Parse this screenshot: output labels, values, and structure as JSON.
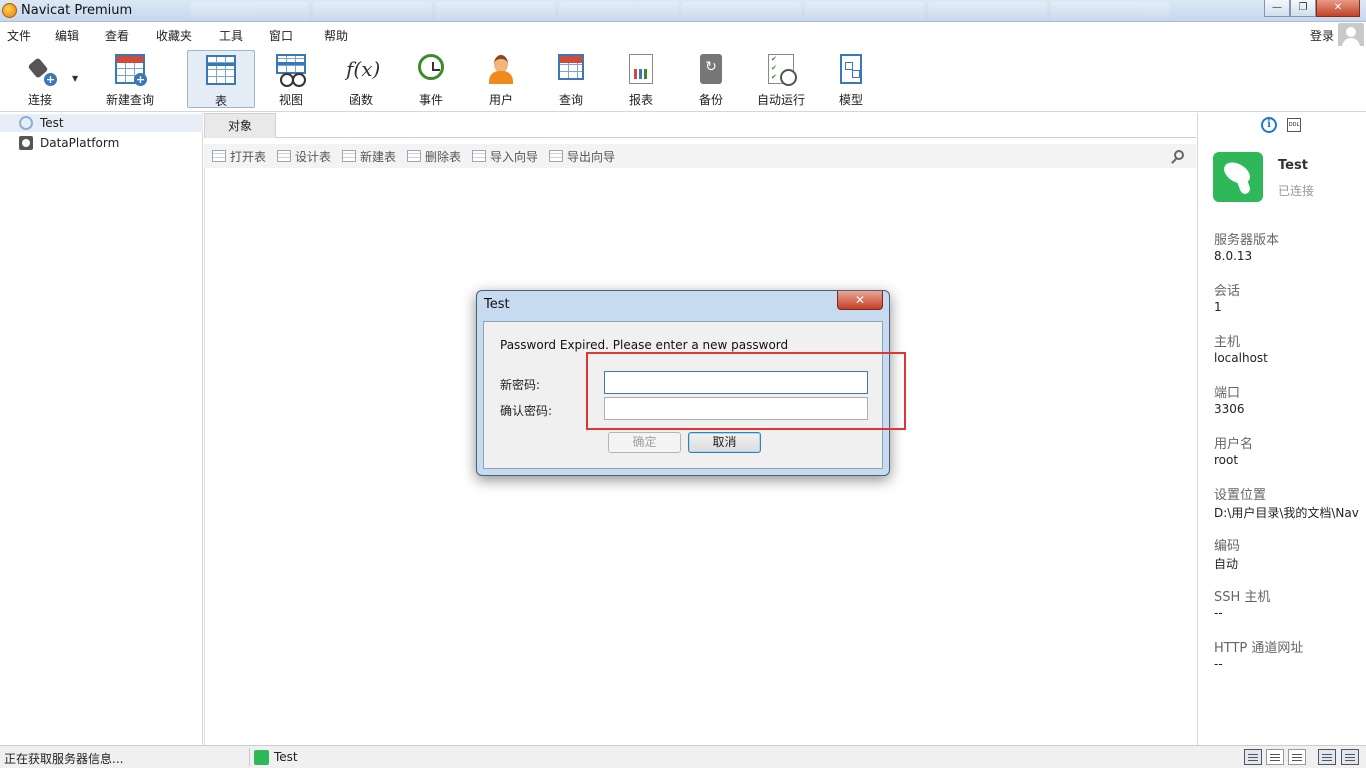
{
  "window": {
    "title": "Navicat Premium",
    "controls": [
      "—",
      "❐",
      "✕"
    ]
  },
  "menu": {
    "items": [
      "文件",
      "编辑",
      "查看",
      "收藏夹",
      "工具",
      "窗口",
      "帮助"
    ],
    "login_label": "登录"
  },
  "toolbar": {
    "connect_label": "连接",
    "new_query_label": "新建查询",
    "buttons": [
      {
        "label": "表",
        "icon": "table-icon",
        "active": true
      },
      {
        "label": "视图",
        "icon": "view-icon"
      },
      {
        "label": "函数",
        "icon": "function-icon",
        "glyph": "f(x)"
      },
      {
        "label": "事件",
        "icon": "event-clock-icon"
      },
      {
        "label": "用户",
        "icon": "user-icon"
      },
      {
        "label": "查询",
        "icon": "query-icon"
      },
      {
        "label": "报表",
        "icon": "report-icon"
      },
      {
        "label": "备份",
        "icon": "backup-icon"
      },
      {
        "label": "自动运行",
        "icon": "automation-icon"
      },
      {
        "label": "模型",
        "icon": "model-icon"
      }
    ]
  },
  "navigator": {
    "items": [
      {
        "label": "Test",
        "icon": "connection-icon",
        "selected": true
      },
      {
        "label": "DataPlatform",
        "icon": "database-icon",
        "selected": false
      }
    ]
  },
  "objects": {
    "tab_label": "对象",
    "actions": [
      "打开表",
      "设计表",
      "新建表",
      "删除表",
      "导入向导",
      "导出向导"
    ]
  },
  "info_panel": {
    "connection_name": "Test",
    "connection_status": "已连接",
    "properties": [
      {
        "label": "服务器版本",
        "value": "8.0.13"
      },
      {
        "label": "会话",
        "value": "1"
      },
      {
        "label": "主机",
        "value": "localhost"
      },
      {
        "label": "端口",
        "value": "3306"
      },
      {
        "label": "用户名",
        "value": "root"
      },
      {
        "label": "设置位置",
        "value": "D:\\用户目录\\我的文档\\Nav"
      },
      {
        "label": "编码",
        "value": "自动"
      },
      {
        "label": "SSH 主机",
        "value": "--"
      },
      {
        "label": "HTTP 通道网址",
        "value": "--"
      }
    ],
    "ddl_icon_text": "DDL"
  },
  "dialog": {
    "title": "Test",
    "close_glyph": "✕",
    "message": "Password Expired. Please enter a new password",
    "new_password_label": "新密码:",
    "new_password_value": "",
    "confirm_password_label": "确认密码:",
    "confirm_password_value": "",
    "ok_label": "确定",
    "cancel_label": "取消"
  },
  "statusbar": {
    "status_text": "正在获取服务器信息...",
    "active_connection": "Test"
  },
  "colors": {
    "highlight_box": "#e03535",
    "mysql_green": "#2fb85a",
    "accent_blue": "#1e78d0"
  }
}
